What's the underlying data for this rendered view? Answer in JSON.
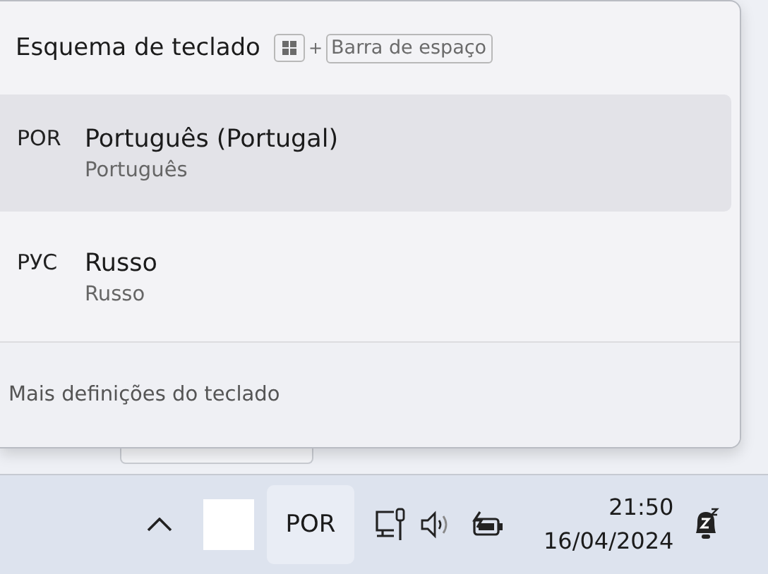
{
  "flyout": {
    "title": "Esquema de teclado",
    "shortcut": {
      "plus": "+",
      "key": "Barra de espaço"
    },
    "layouts": [
      {
        "code": "POR",
        "name": "Português (Portugal)",
        "layout": "Português",
        "selected": true
      },
      {
        "code": "РУС",
        "name": "Russo",
        "layout": "Russo",
        "selected": false
      }
    ],
    "footer_link": "Mais definições do teclado"
  },
  "taskbar": {
    "language": "POR",
    "time": "21:50",
    "date": "16/04/2024"
  }
}
